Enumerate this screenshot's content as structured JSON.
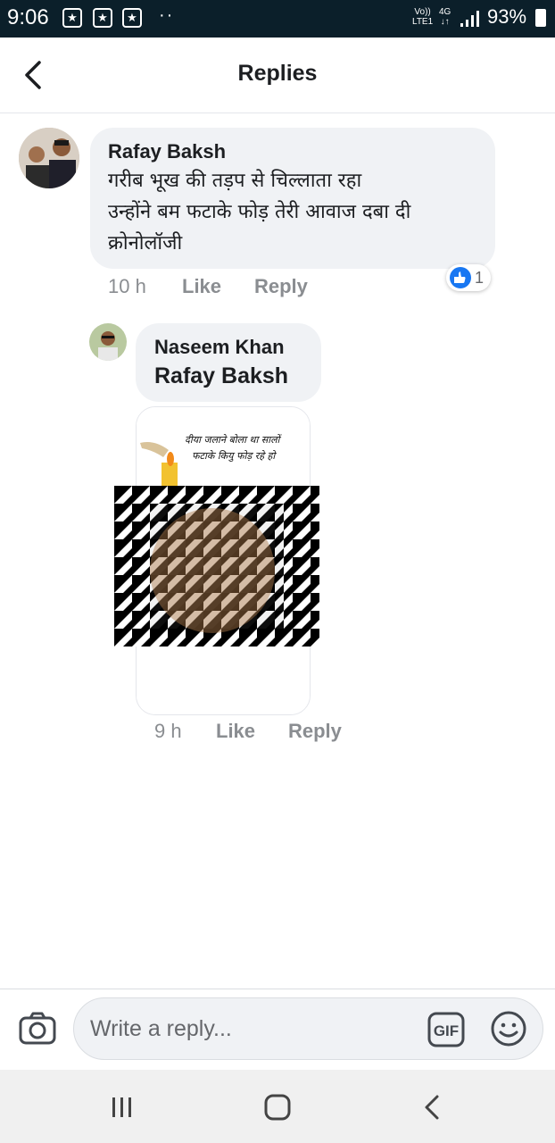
{
  "status_bar": {
    "time": "9:06",
    "net_top": "Vo))",
    "net_bottom": "LTE1",
    "net_type": "4G",
    "battery": "93%"
  },
  "header": {
    "title": "Replies"
  },
  "comment": {
    "author": "Rafay Baksh",
    "text": "गरीब भूख की तड़प से चिल्लाता रहा\nउन्होंने बम फटाके फोड़ तेरी आवाज दबा दी\nक्रोनोलॉजी",
    "time": "10 h",
    "like_label": "Like",
    "reply_label": "Reply",
    "reaction_count": "1"
  },
  "reply": {
    "author": "Naseem Khan",
    "mention": "Rafay Baksh",
    "image_caption_line1": "दीया जलाने बोला था सालों",
    "image_caption_line2": "फटाके कियु फोड़ रहे हो",
    "time": "9 h",
    "like_label": "Like",
    "reply_label": "Reply"
  },
  "composer": {
    "placeholder": "Write a reply...",
    "gif_label": "GIF"
  },
  "colors": {
    "accent": "#1877f2",
    "bubble": "#f0f2f5",
    "meta": "#8a8d91",
    "status_bar": "#0b1f2a"
  }
}
